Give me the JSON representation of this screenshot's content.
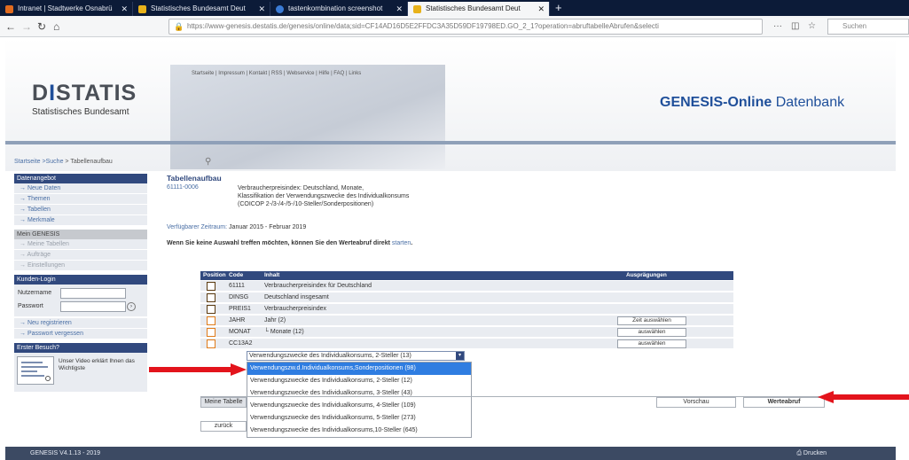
{
  "browser": {
    "tabs": [
      {
        "label": "Intranet | Stadtwerke Osnabrü",
        "color": "#e06b1f"
      },
      {
        "label": "Statistisches Bundesamt Deut",
        "color": "#e8b21a"
      },
      {
        "label": "tastenkombination screenshot",
        "color": "#3a7bd5"
      },
      {
        "label": "Statistisches Bundesamt Deut",
        "color": "#e8b21a"
      }
    ],
    "new_tab": "+",
    "url": "https://www-genesis.destatis.de/genesis/online/data;sid=CF14AD16D5E2FFDC3A35D59DF19798ED.GO_2_1?operation=abruftabelleAbrufen&selecti",
    "search_placeholder": "Suchen",
    "menu_glyph": "···"
  },
  "header": {
    "logo_main_a": "D",
    "logo_main_accent": "I",
    "logo_main_b": "STATIS",
    "logo_sub": "Statistisches Bundesamt",
    "top_links": "Startseite | Impressum | Kontakt | RSS | Webservice | Hilfe | FAQ | Links",
    "app_title_bold": "GENESIS-Online",
    "app_title_rest": " Datenbank"
  },
  "breadcrumb": {
    "home": "Startseite",
    "search": ">Suche",
    "current": "> Tabellenaufbau"
  },
  "sidebar": {
    "section_data": "Datenangebot",
    "data_items": [
      "→ Neue Daten",
      "→ Themen",
      "→ Tabellen",
      "→ Merkmale"
    ],
    "section_mine": "Mein GENESIS",
    "mine_items": [
      "→ Meine Tabellen",
      "→ Aufträge",
      "→ Einstellungen"
    ],
    "section_login": "Kunden-Login",
    "user_label": "Nutzername",
    "pass_label": "Passwort",
    "go_glyph": "›",
    "account_items": [
      "→ Neu registrieren",
      "→ Passwort vergessen"
    ],
    "section_first": "Erster Besuch?",
    "video_text": "Unser Video erklärt Ihnen das Wichtigste"
  },
  "main": {
    "title": "Tabellenaufbau",
    "code": "61111-0006",
    "desc_lines": [
      "Verbraucherpreisindex: Deutschland, Monate,",
      "Klassifikation der Verwendungszwecke des Individualkonsums",
      "(COICOP 2-/3-/4-/5-/10-Steller/Sonderpositionen)"
    ],
    "period_label": "Verfügbarer Zeitraum:",
    "period_value": "Januar 2015 - Februar 2019",
    "hint_text": "Wenn Sie keine Auswahl treffen möchten, können Sie den Werteabruf direkt",
    "hint_link": "starten",
    "hint_end": "."
  },
  "table": {
    "headers": {
      "position": "Position",
      "code": "Code",
      "content": "Inhalt",
      "values": "Ausprägungen"
    },
    "rows": [
      {
        "code": "61111",
        "content": "Verbraucherpreisindex für Deutschland",
        "button": ""
      },
      {
        "code": "DINSG",
        "content": "Deutschland insgesamt",
        "button": ""
      },
      {
        "code": "PREIS1",
        "content": "Verbraucherpreisindex",
        "button": ""
      },
      {
        "code": "JAHR",
        "content": "Jahr (2)",
        "button": "Zeit auswählen"
      },
      {
        "code": "MONAT",
        "content": "└ Monate (12)",
        "button": "auswählen"
      },
      {
        "code": "CC13A2",
        "content": "",
        "button": "auswählen"
      }
    ]
  },
  "dropdown": {
    "selected": "Verwendungszwecke des Individualkonsums, 2-Steller (13)",
    "arrow": "▾",
    "options": [
      "Verwendungszw.d.Individualkonsums,Sonderpositionen (98)",
      "Verwendungszwecke des Individualkonsums, 2-Steller (12)",
      "Verwendungszwecke des Individualkonsums, 3-Steller (43)",
      "Verwendungszwecke des Individualkonsums, 4-Steller (109)",
      "Verwendungszwecke des Individualkonsums, 5-Steller (273)",
      "Verwendungszwecke des Individualkonsums,10-Steller (645)"
    ]
  },
  "buttons": {
    "my_table": "Meine Tabelle",
    "back": "zurück",
    "preview": "Vorschau",
    "fetch": "Werteabruf"
  },
  "footer": {
    "version": "GENESIS V4.1.13 - 2019",
    "print": "Drucken"
  },
  "colors": {
    "brand": "#31497e",
    "highlight": "#2f7de1",
    "annotation": "#e3141c"
  }
}
